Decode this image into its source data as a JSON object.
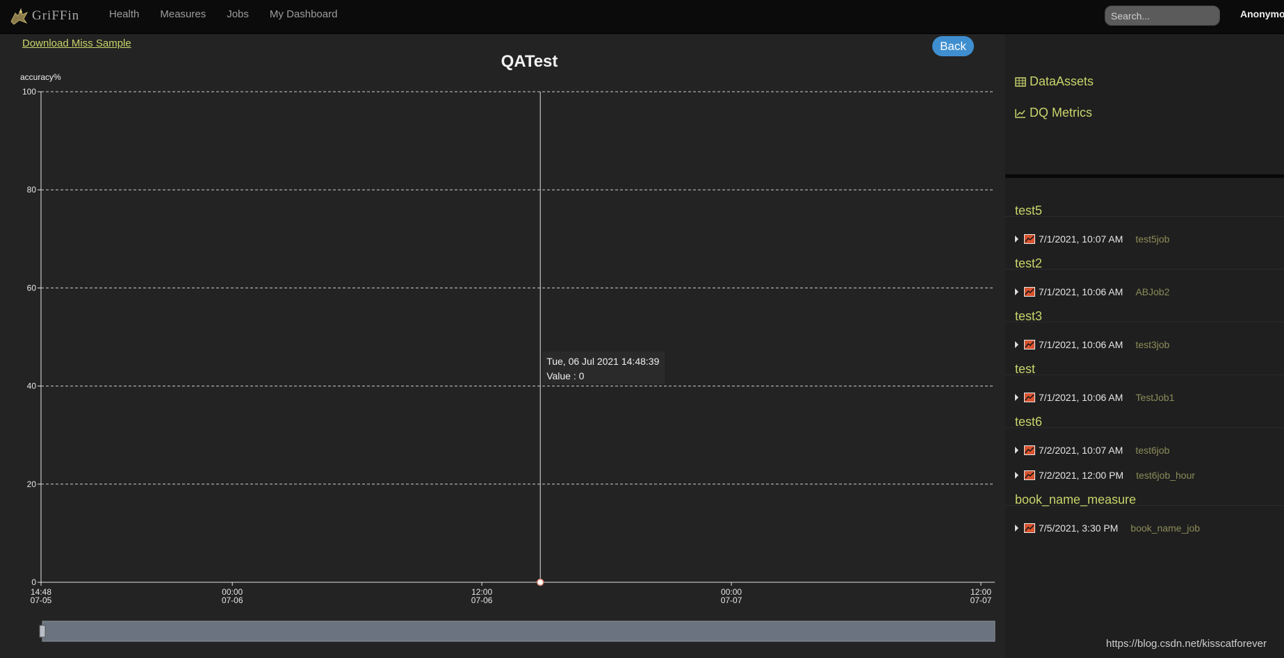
{
  "navbar": {
    "brand": "GriFFin",
    "links": [
      "Health",
      "Measures",
      "Jobs",
      "My Dashboard"
    ],
    "search_placeholder": "Search...",
    "user": "Anonymous"
  },
  "main": {
    "download_link": "Download Miss Sample",
    "back_button": "Back"
  },
  "chart_data": {
    "type": "line",
    "title": "QATest",
    "ylabel": "accuracy%",
    "xlabel": "",
    "ylim": [
      0,
      100
    ],
    "yticks": [
      0,
      20,
      40,
      60,
      80,
      100
    ],
    "xticks": [
      {
        "time": "14:48",
        "date": "07-05"
      },
      {
        "time": "00:00",
        "date": "07-06"
      },
      {
        "time": "12:00",
        "date": "07-06"
      },
      {
        "time": "00:00",
        "date": "07-07"
      },
      {
        "time": "12:00",
        "date": "07-07"
      }
    ],
    "grid": true,
    "series": [
      {
        "points": [
          {
            "x": "2021-07-06 14:48:39",
            "y": 0
          }
        ]
      }
    ],
    "tooltip": {
      "date": "Tue, 06 Jul 2021 14:48:39",
      "value_label": "Value : 0"
    },
    "colors": {
      "gridline": "#cfcfcf",
      "marker": "#ffffff",
      "slider": "#6b7380"
    }
  },
  "sidebar": {
    "nav": [
      {
        "label": "DataAssets",
        "icon": "table-icon"
      },
      {
        "label": "DQ Metrics",
        "icon": "line-chart-icon"
      }
    ],
    "groups": [
      {
        "title": "test5",
        "rows": [
          {
            "time": "7/1/2021, 10:07 AM",
            "job": "test5job"
          }
        ]
      },
      {
        "title": "test2",
        "rows": [
          {
            "time": "7/1/2021, 10:06 AM",
            "job": "ABJob2"
          }
        ]
      },
      {
        "title": "test3",
        "rows": [
          {
            "time": "7/1/2021, 10:06 AM",
            "job": "test3job"
          }
        ]
      },
      {
        "title": "test",
        "rows": [
          {
            "time": "7/1/2021, 10:06 AM",
            "job": "TestJob1"
          }
        ]
      },
      {
        "title": "test6",
        "rows": [
          {
            "time": "7/2/2021, 10:07 AM",
            "job": "test6job"
          },
          {
            "time": "7/2/2021, 12:00 PM",
            "job": "test6job_hour"
          }
        ]
      },
      {
        "title": "book_name_measure",
        "rows": [
          {
            "time": "7/5/2021, 3:30 PM",
            "job": "book_name_job"
          }
        ]
      }
    ]
  },
  "watermark": "https://blog.csdn.net/kisscatforever"
}
